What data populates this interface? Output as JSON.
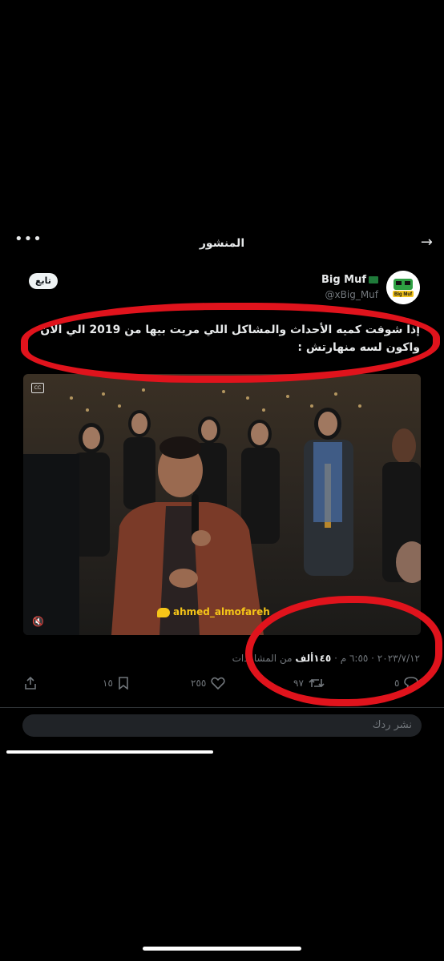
{
  "header": {
    "title": "المنشور"
  },
  "author": {
    "name": "Big Muf",
    "handle": "@xBig_Muf",
    "follow_label": "تابع",
    "avatar_text": "Big Muf"
  },
  "tweet": {
    "text_line1": "إذا شوفت كميه الأحداث والمشاكل اللي مريت بيها من 2019 الي الان",
    "text_line2": "واكون لسه منهارتش :"
  },
  "media": {
    "watermark": "ahmed_almofareh",
    "cc_label": "CC"
  },
  "meta": {
    "date": "٢٠٢٣/٧/١٢",
    "time": "٦:٥٥ م",
    "views_value": "١٤٥ألف",
    "views_label": "من المشاهدات"
  },
  "actions": {
    "replies": "٥",
    "reposts": "٩٧",
    "likes": "٢٥٥",
    "bookmarks": "١٥"
  },
  "reply": {
    "placeholder": "نشر ردك"
  },
  "colors": {
    "annotation": "#e0131c",
    "text": "#e7e9ea",
    "muted": "#71767b"
  }
}
